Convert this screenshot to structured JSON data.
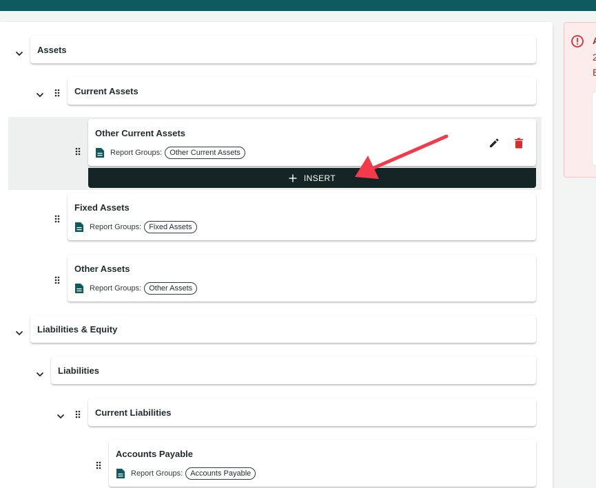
{
  "colors": {
    "brand": "#0f5a5f",
    "insert_bg": "#152526",
    "danger": "#d32f2f",
    "arrow": "#f23a4b",
    "alert_text": "#b3261e"
  },
  "alert": {
    "lines": [
      "A",
      "2",
      "E"
    ],
    "icon": "alert-circle-icon"
  },
  "labels": {
    "report_groups": "Report Groups:",
    "insert": "INSERT"
  },
  "tree": {
    "assets": {
      "title": "Assets"
    },
    "current_assets": {
      "title": "Current Assets"
    },
    "other_current_assets": {
      "title": "Other Current Assets",
      "group": "Other Current Assets"
    },
    "fixed_assets": {
      "title": "Fixed Assets",
      "group": "Fixed Assets"
    },
    "other_assets": {
      "title": "Other Assets",
      "group": "Other Assets"
    },
    "liabilities_equity": {
      "title": "Liabilities & Equity"
    },
    "liabilities": {
      "title": "Liabilities"
    },
    "current_liabilities": {
      "title": "Current Liabilities"
    },
    "accounts_payable": {
      "title": "Accounts Payable",
      "group": "Accounts Payable"
    }
  }
}
